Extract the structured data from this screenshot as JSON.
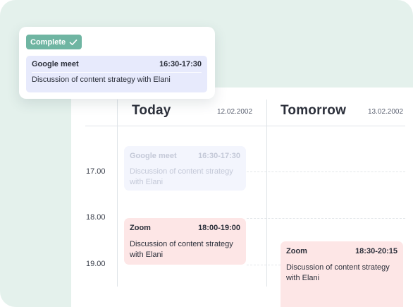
{
  "popup": {
    "badge_label": "Complete",
    "event": {
      "title": "Google meet",
      "time": "16:30-17:30",
      "description": "Discussion of content strategy with Elani"
    }
  },
  "days": [
    {
      "title": "Today",
      "date": "12.02.2002"
    },
    {
      "title": "Tomorrow",
      "date": "13.02.2002"
    }
  ],
  "times": [
    "17.00",
    "18.00",
    "19.00"
  ],
  "events": [
    {
      "title": "Google meet",
      "time": "16:30-17:30",
      "description": "Discussion of content strategy with Elani",
      "status": "completed"
    },
    {
      "title": "Zoom",
      "time": "18:00-19:00",
      "description": "Discussion of content strategy with Elani",
      "status": "upcoming"
    },
    {
      "title": "Zoom",
      "time": "18:30-20:15",
      "description": "Discussion of content strategy with Elani",
      "status": "upcoming"
    }
  ],
  "colors": {
    "mint_background": "#e4f1ec",
    "complete_badge": "#6fb5a2",
    "completed_event": "#e7eafc",
    "zoom_event": "#fde6e6"
  }
}
